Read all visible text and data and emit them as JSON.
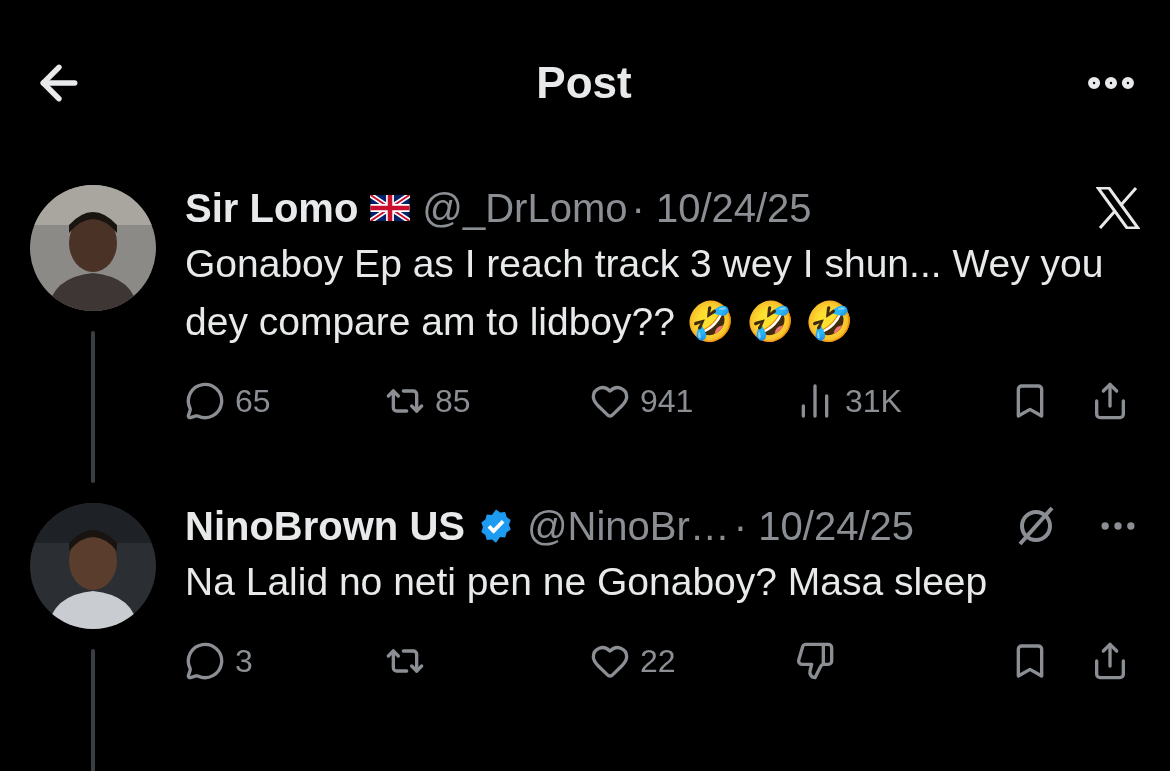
{
  "header": {
    "title": "Post"
  },
  "posts": [
    {
      "name": "Sir Lomo",
      "badge": {
        "kind": "uk-flag"
      },
      "handle": "@_DrLomo",
      "date": "· 10/24/25",
      "corner_icons": [
        {
          "kind": "x-logo"
        }
      ],
      "text": "Gonaboy Ep as I reach track 3 wey I shun... Wey you dey compare am to lidboy?? 🤣 🤣 🤣",
      "thread": true,
      "actions": [
        {
          "kind": "reply",
          "count": "65"
        },
        {
          "kind": "repost",
          "count": "85"
        },
        {
          "kind": "like",
          "count": "941"
        },
        {
          "kind": "views",
          "count": "31K"
        },
        {
          "kind": "bookmark"
        },
        {
          "kind": "share"
        }
      ]
    },
    {
      "name": "NinoBrown US",
      "badge": {
        "kind": "verified"
      },
      "handle": "@NinoBr…",
      "date": "· 10/24/25",
      "corner_icons": [
        {
          "kind": "muted"
        },
        {
          "kind": "more"
        }
      ],
      "text": "Na Lalid no neti pen ne Gonaboy? Masa sleep",
      "thread": true,
      "actions": [
        {
          "kind": "reply",
          "count": "3"
        },
        {
          "kind": "repost"
        },
        {
          "kind": "like",
          "count": "22"
        },
        {
          "kind": "downvote"
        },
        {
          "kind": "bookmark"
        },
        {
          "kind": "share"
        }
      ]
    }
  ]
}
